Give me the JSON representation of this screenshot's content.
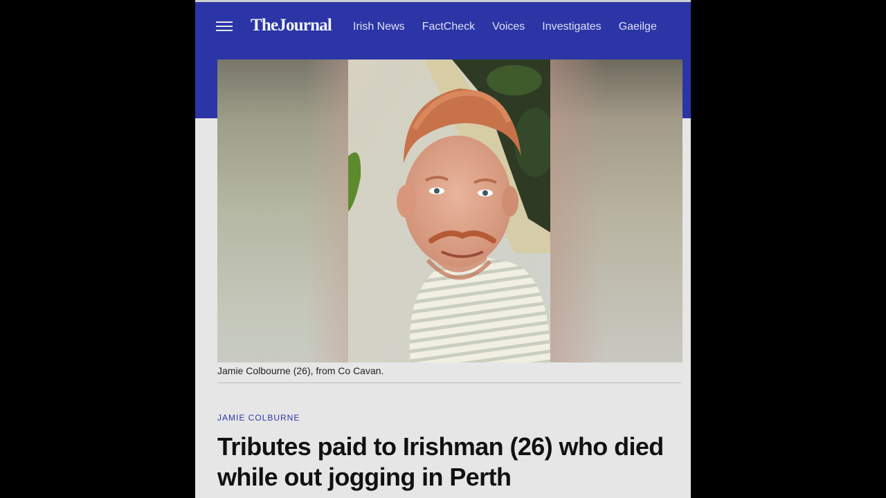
{
  "header": {
    "logo": "TheJournal",
    "nav": [
      "Irish News",
      "FactCheck",
      "Voices",
      "Investigates",
      "Gaeilge"
    ]
  },
  "article": {
    "caption": "Jamie Colbourne (26), from Co Cavan.",
    "kicker": "JAMIE COLBURNE",
    "headline": "Tributes paid to Irishman (26) who died while out jogging in Perth"
  },
  "icons": {
    "menu": "hamburger-menu-icon"
  },
  "colors": {
    "brand_blue": "#2b35a6",
    "background": "#e6e6e6",
    "outer": "#000000"
  }
}
